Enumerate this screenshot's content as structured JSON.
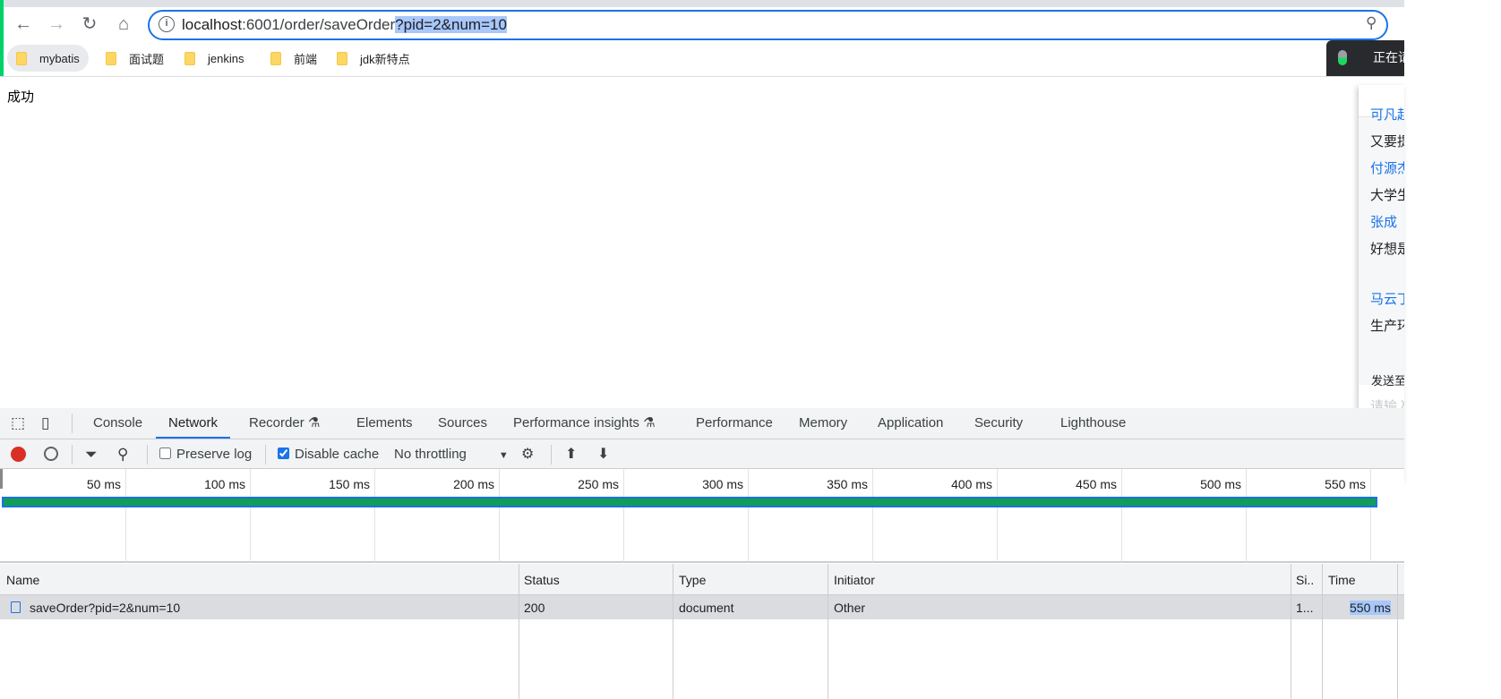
{
  "browser": {
    "url_host": "localhost",
    "url_path": ":6001/order/saveOrder",
    "url_query": "?pid=2&num=10",
    "bookmarks": [
      {
        "label": "mybatis"
      },
      {
        "label": "面试题"
      },
      {
        "label": "jenkins"
      },
      {
        "label": "前端"
      },
      {
        "label": "jdk新特点"
      }
    ],
    "voice_text": "正在请"
  },
  "page": {
    "content": "成功"
  },
  "popup": {
    "items": [
      {
        "text": "可凡起",
        "color": "blue"
      },
      {
        "text": "又要提",
        "color": "black"
      },
      {
        "text": "付源杰",
        "color": "blue"
      },
      {
        "text": "大学生",
        "color": "black"
      },
      {
        "text": "张成",
        "color": "blue"
      },
      {
        "text": "好想是",
        "color": "black"
      },
      {
        "text": "马云丁",
        "color": "blue"
      },
      {
        "text": "生产环",
        "color": "black"
      }
    ],
    "send_label": "发送至",
    "input_placeholder": "请输入"
  },
  "devtools": {
    "tabs": [
      "Console",
      "Network",
      "Recorder",
      "Elements",
      "Sources",
      "Performance insights",
      "Performance",
      "Memory",
      "Application",
      "Security",
      "Lighthouse"
    ],
    "active_tab": "Network",
    "toolbar": {
      "preserve_log": "Preserve log",
      "preserve_log_checked": false,
      "disable_cache": "Disable cache",
      "disable_cache_checked": true,
      "throttling": "No throttling"
    },
    "timeline_ticks": [
      "50 ms",
      "100 ms",
      "150 ms",
      "200 ms",
      "250 ms",
      "300 ms",
      "350 ms",
      "400 ms",
      "450 ms",
      "500 ms",
      "550 ms"
    ],
    "request_progress": 100,
    "columns": [
      "Name",
      "Status",
      "Type",
      "Initiator",
      "Si..",
      "Time"
    ],
    "rows": [
      {
        "name": "saveOrder?pid=2&num=10",
        "status": "200",
        "type": "document",
        "initiator": "Other",
        "size": "1...",
        "time": "550 ms"
      }
    ]
  },
  "colors": {
    "accent": "#1a73e8",
    "bar": "#0f9d58",
    "record": "#d93025"
  }
}
